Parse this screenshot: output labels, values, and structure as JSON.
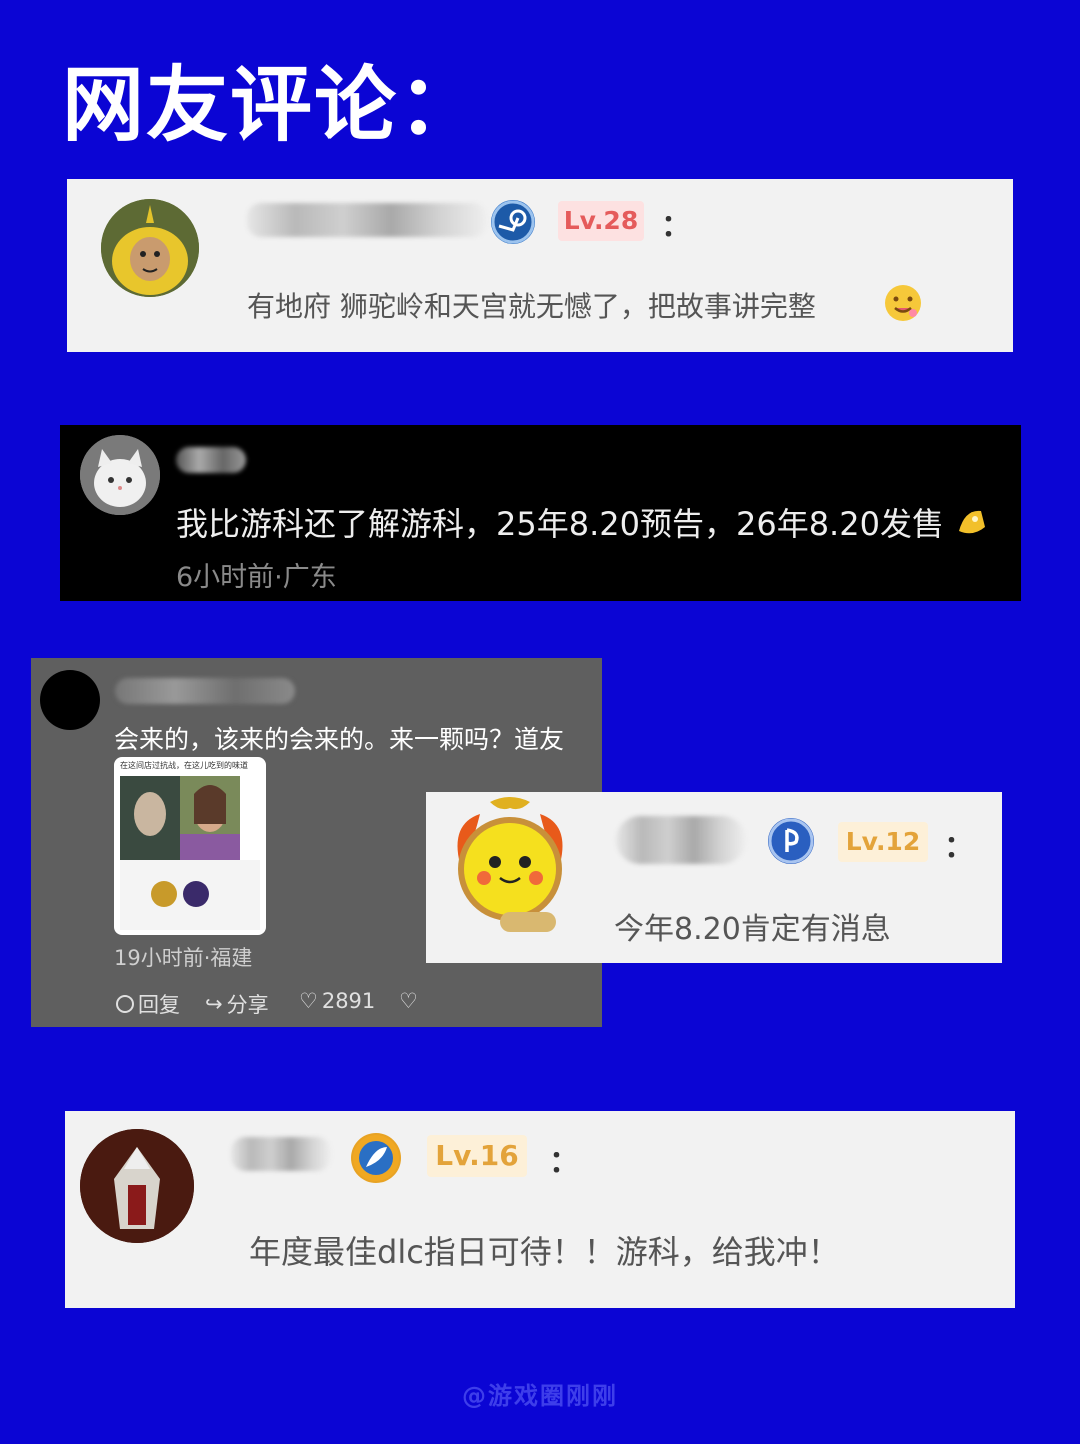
{
  "page_title": "网友评论：",
  "watermark": "@游戏圈刚刚",
  "comments": [
    {
      "level": "Lv.28",
      "more": "：",
      "text": "有地府 狮驼岭和天宫就无憾了，把故事讲完整",
      "badge_icon": "steam-icon",
      "emoji_icon": "drooling-face-emoji"
    },
    {
      "text": "我比游科还了解游科，25年8.20预告，26年8.20发售",
      "meta": "6小时前·广东",
      "emoji_icon": "cheers-emoji"
    },
    {
      "text": "会来的，该来的会来的。来一颗吗？道友",
      "image_caption": "在这间店过抗战，在这儿吃到的味道",
      "meta": "19小时前·福建",
      "actions": {
        "reply": "回复",
        "share": "分享",
        "likes": "2891"
      }
    },
    {
      "level": "Lv.12",
      "more": "：",
      "text": "今年8.20肯定有消息",
      "badge_icon": "playstation-icon"
    },
    {
      "level": "Lv.16",
      "more": "：",
      "text": "年度最佳dlc指日可待！！游科，给我冲！",
      "badge_icon": "feather-badge-icon"
    }
  ]
}
